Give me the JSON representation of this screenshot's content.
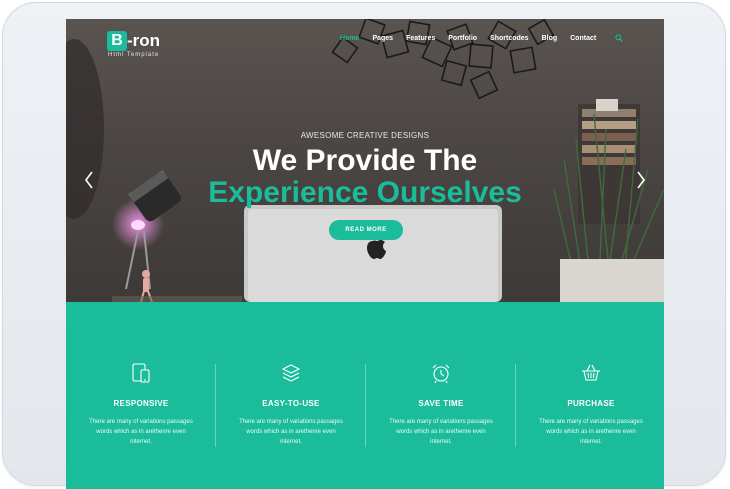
{
  "brand": {
    "logo_letter": "B",
    "logo_rest": "-ron",
    "tagline": "Html Template",
    "accent_color": "#1bbc9b"
  },
  "nav": {
    "items": [
      {
        "label": "Home",
        "active": true
      },
      {
        "label": "Pages",
        "active": false
      },
      {
        "label": "Features",
        "active": false
      },
      {
        "label": "Portfolio",
        "active": false
      },
      {
        "label": "Shortcodes",
        "active": false
      },
      {
        "label": "Blog",
        "active": false
      },
      {
        "label": "Contact",
        "active": false
      }
    ],
    "search_icon": "search-icon"
  },
  "hero": {
    "subtitle": "AWESOME CREATIVE DESIGNS",
    "line1": "We Provide The",
    "line2": "Experience Ourselves",
    "button": "READ MORE",
    "prev_icon": "chevron-left-icon",
    "next_icon": "chevron-right-icon"
  },
  "features": [
    {
      "icon": "devices-icon",
      "title": "RESPONSIVE",
      "desc": "There are many of variations passages words which as in arethenre even internet."
    },
    {
      "icon": "layers-icon",
      "title": "EASY-TO-USE",
      "desc": "There are many of variations passages words which as in arethenre even internet."
    },
    {
      "icon": "alarm-clock-icon",
      "title": "SAVE TIME",
      "desc": "There are many of variations passages words which as in arethenre even internet."
    },
    {
      "icon": "basket-icon",
      "title": "PURCHASE",
      "desc": "There are many of variations passages words which as in arethenre even internet."
    }
  ]
}
